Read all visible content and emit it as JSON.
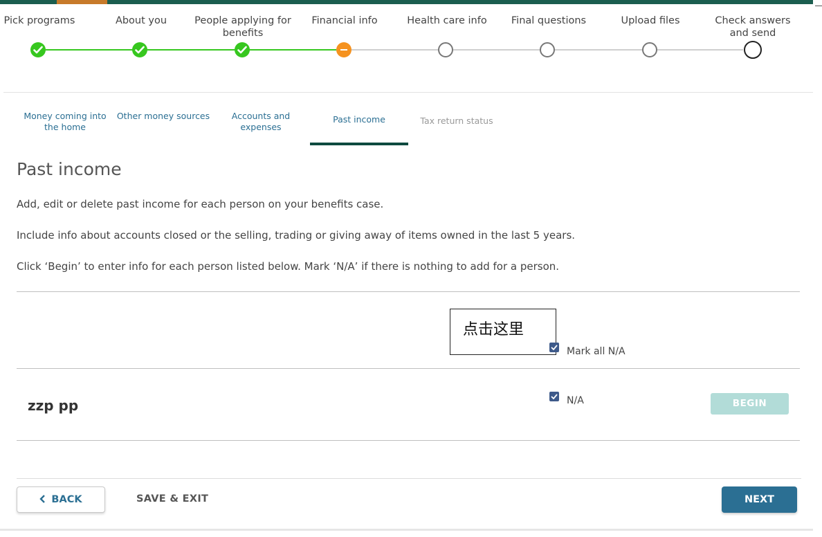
{
  "stepper": {
    "steps": [
      {
        "label": "Pick programs",
        "state": "done"
      },
      {
        "label": "About you",
        "state": "done"
      },
      {
        "label": "People applying for benefits",
        "state": "done"
      },
      {
        "label": "Financial info",
        "state": "current"
      },
      {
        "label": "Health care info",
        "state": "todo"
      },
      {
        "label": "Final questions",
        "state": "todo"
      },
      {
        "label": "Upload files",
        "state": "todo"
      },
      {
        "label": "Check answers and send",
        "state": "todo"
      }
    ]
  },
  "subtabs": [
    {
      "label": "Money coming into the home",
      "state": "enabled"
    },
    {
      "label": "Other money sources",
      "state": "enabled"
    },
    {
      "label": "Accounts and expenses",
      "state": "enabled"
    },
    {
      "label": "Past income",
      "state": "active"
    },
    {
      "label": "Tax return status",
      "state": "disabled"
    }
  ],
  "main": {
    "title": "Past income",
    "para1": "Add, edit or delete past income for each person on your benefits case.",
    "para2": "Include info about accounts closed or the selling, trading or giving away of items owned in the last 5 years.",
    "para3": "Click ‘Begin’ to enter info for each person listed below. Mark ‘N/A’ if there is nothing to add for a person."
  },
  "annotation": {
    "text": "点击这里"
  },
  "mark_all": {
    "label": "Mark all N/A",
    "checked": true
  },
  "person": {
    "name": "zzp pp",
    "na_label": "N/A",
    "na_checked": true,
    "begin_label": "BEGIN"
  },
  "footer": {
    "back_label": "BACK",
    "save_exit_label": "SAVE & EXIT",
    "next_label": "NEXT"
  },
  "colors": {
    "done": "#37c71f",
    "current": "#f5921f",
    "brand": "#1b5e4f",
    "link": "#2b6f93"
  }
}
